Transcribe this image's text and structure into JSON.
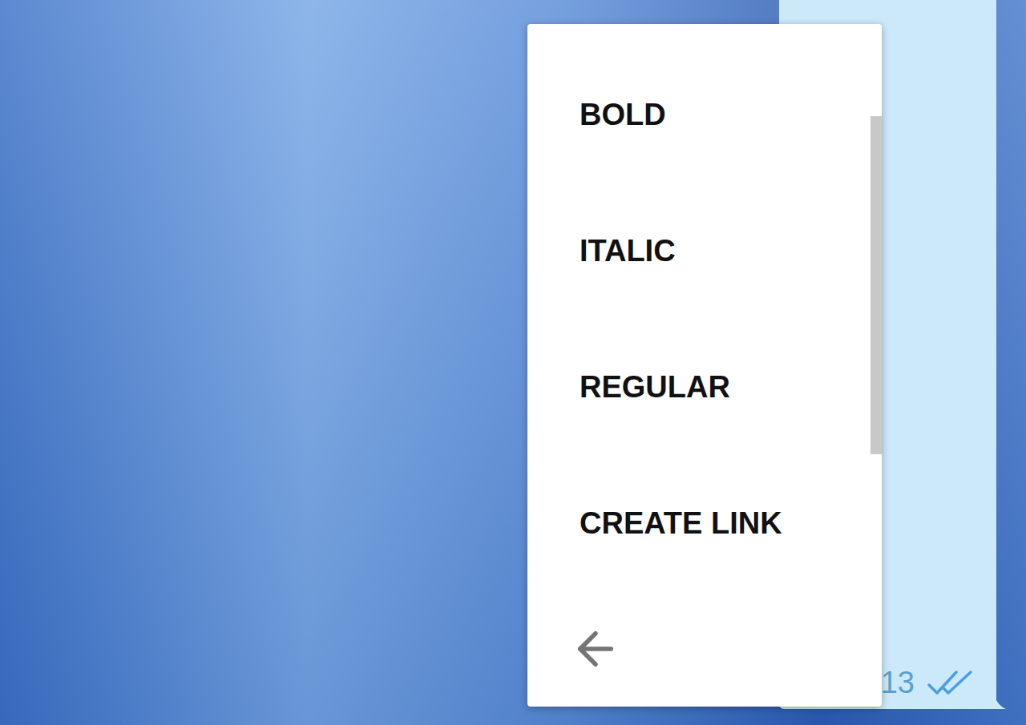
{
  "chat": {
    "background": "photo"
  },
  "message": {
    "time": "13",
    "read": true
  },
  "context_menu": {
    "items": [
      {
        "label": "BOLD"
      },
      {
        "label": "ITALIC"
      },
      {
        "label": "REGULAR"
      },
      {
        "label": "CREATE LINK"
      }
    ],
    "back": true,
    "scrollbar_level": 0.64
  }
}
